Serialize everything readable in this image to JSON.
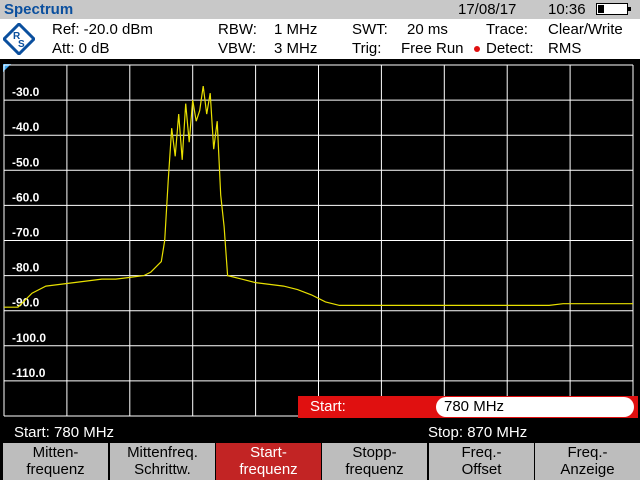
{
  "header": {
    "title": "Spectrum",
    "date": "17/08/17",
    "time": "10:36",
    "battery_level": 0.2
  },
  "settings": {
    "ref": "Ref: -20.0 dBm",
    "att": "Att: 0 dB",
    "rbw": "RBW:",
    "rbw_value": "1 MHz",
    "vbw": "VBW:",
    "vbw_value": "3 MHz",
    "swt": "SWT:",
    "swt_value": "20 ms",
    "trig": "Trig:",
    "trig_value": "Free Run",
    "trace": "Trace:",
    "trace_value": "Clear/Write",
    "detect": "Detect:",
    "detect_value": "RMS"
  },
  "plot": {
    "y_ticks": [
      "-30.0",
      "-40.0",
      "-50.0",
      "-60.0",
      "-70.0",
      "-80.0",
      "-90.0",
      "-100.0",
      "-110.0"
    ],
    "trace_color": "#e8e000"
  },
  "input": {
    "label": "Start:",
    "value": "780 MHz"
  },
  "status": {
    "start": "Start:  780 MHz",
    "stop": "Stop: 870 MHz"
  },
  "softkeys": [
    {
      "line1": "Mitten-",
      "line2": "frequenz",
      "active": false
    },
    {
      "line1": "Mittenfreq.",
      "line2": "Schrittw.",
      "active": false
    },
    {
      "line1": "Start-",
      "line2": "frequenz",
      "active": true
    },
    {
      "line1": "Stopp-",
      "line2": "frequenz",
      "active": false
    },
    {
      "line1": "Freq.-",
      "line2": "Offset",
      "active": false
    },
    {
      "line1": "Freq.-",
      "line2": "Anzeige",
      "active": false
    }
  ],
  "chart_data": {
    "type": "line",
    "title": "",
    "xlabel": "",
    "ylabel": "",
    "x_unit": "MHz",
    "y_unit": "dBm",
    "xlim": [
      780,
      870
    ],
    "ylim": [
      -120,
      -20
    ],
    "grid": true,
    "series": [
      {
        "x": [
          780,
          782,
          784,
          786,
          788,
          790,
          792,
          794,
          796,
          798,
          800,
          801,
          802,
          802.5,
          803,
          803.5,
          804,
          804.5,
          805,
          805.5,
          806,
          806.5,
          807,
          807.5,
          808,
          808.5,
          809,
          809.5,
          810,
          810.5,
          811,
          811.5,
          812,
          814,
          816,
          818,
          820,
          822,
          824,
          826,
          828,
          830,
          832,
          834,
          836,
          838,
          840,
          842,
          844,
          846,
          848,
          850,
          852,
          854,
          856,
          858,
          860,
          862,
          864,
          866,
          868,
          870
        ],
        "y": [
          -89,
          -89,
          -85,
          -83,
          -82.5,
          -82,
          -81.5,
          -81,
          -81,
          -80.5,
          -80,
          -79,
          -77,
          -76,
          -70,
          -53,
          -38,
          -46,
          -34,
          -47,
          -31,
          -42,
          -30,
          -36,
          -33,
          -26,
          -34,
          -28,
          -44,
          -36,
          -57,
          -66,
          -80,
          -81,
          -82,
          -82.5,
          -83,
          -84,
          -85.5,
          -87.5,
          -88.5,
          -88.5,
          -88.5,
          -88.5,
          -88.5,
          -88.5,
          -88.5,
          -88.5,
          -88.5,
          -88.5,
          -88.5,
          -88.5,
          -88.5,
          -88.5,
          -88.5,
          -88.5,
          -88,
          -88,
          -88,
          -88,
          -88,
          -88
        ]
      }
    ]
  }
}
